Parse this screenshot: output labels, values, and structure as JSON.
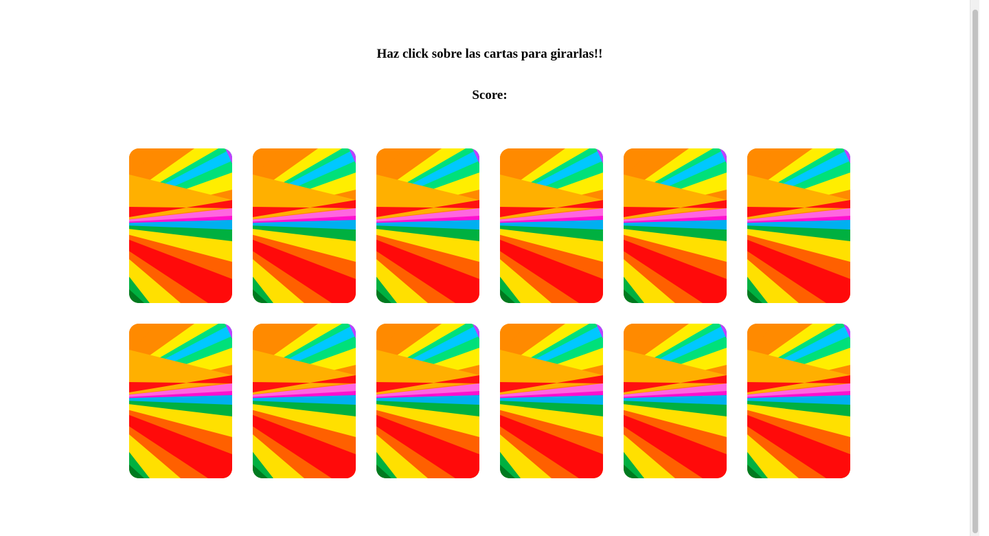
{
  "game": {
    "instructions": "Haz click sobre las cartas para girarlas!!",
    "score_label": "Score:",
    "score_value": ""
  },
  "cards": [
    {
      "state": "face-down",
      "back": "rainbow-rays"
    },
    {
      "state": "face-down",
      "back": "rainbow-rays"
    },
    {
      "state": "face-down",
      "back": "rainbow-rays"
    },
    {
      "state": "face-down",
      "back": "rainbow-rays"
    },
    {
      "state": "face-down",
      "back": "rainbow-rays"
    },
    {
      "state": "face-down",
      "back": "rainbow-rays"
    },
    {
      "state": "face-down",
      "back": "rainbow-rays"
    },
    {
      "state": "face-down",
      "back": "rainbow-rays"
    },
    {
      "state": "face-down",
      "back": "rainbow-rays"
    },
    {
      "state": "face-down",
      "back": "rainbow-rays"
    },
    {
      "state": "face-down",
      "back": "rainbow-rays"
    },
    {
      "state": "face-down",
      "back": "rainbow-rays"
    }
  ],
  "card_back_colors": [
    "#ff8a00",
    "#ffb000",
    "#ffee00",
    "#00e07a",
    "#00c8ff",
    "#c040ff",
    "#ff1010",
    "#ff66e0",
    "#ff10d0",
    "#00b0f0",
    "#00b040",
    "#ffe000",
    "#ff6000",
    "#ff0a0a"
  ]
}
